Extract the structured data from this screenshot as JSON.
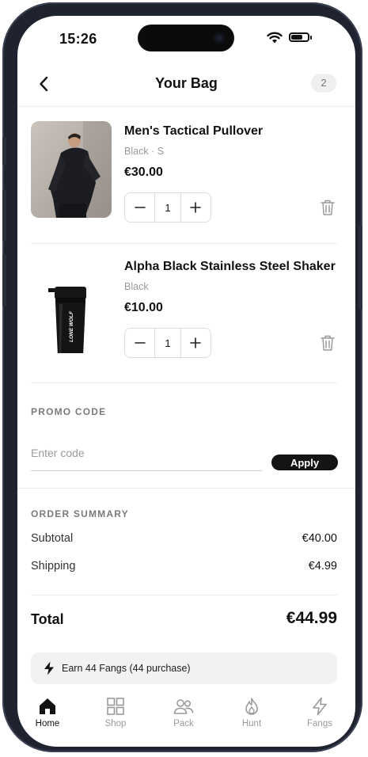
{
  "status_bar": {
    "time": "15:26"
  },
  "header": {
    "title": "Your Bag",
    "item_count": "2"
  },
  "items": [
    {
      "name": "Men's Tactical Pullover",
      "variant": "Black · S",
      "price": "€30.00",
      "quantity": "1"
    },
    {
      "name": "Alpha Black Stainless Steel Shaker",
      "variant": "Black",
      "price": "€10.00",
      "quantity": "1",
      "bottle_text": "LONE WOLF"
    }
  ],
  "promo": {
    "label": "PROMO CODE",
    "placeholder": "Enter code",
    "apply_label": "Apply"
  },
  "summary": {
    "label": "ORDER SUMMARY",
    "subtotal_label": "Subtotal",
    "subtotal_value": "€40.00",
    "shipping_label": "Shipping",
    "shipping_value": "€4.99",
    "total_label": "Total",
    "total_value": "€44.99"
  },
  "rewards": {
    "text": "Earn 44 Fangs (44 purchase)",
    "icon": "bolt-icon"
  },
  "tabs": [
    {
      "label": "Home",
      "icon": "home-icon",
      "active": true
    },
    {
      "label": "Shop",
      "icon": "grid-icon",
      "active": false
    },
    {
      "label": "Pack",
      "icon": "users-icon",
      "active": false
    },
    {
      "label": "Hunt",
      "icon": "flame-icon",
      "active": false
    },
    {
      "label": "Fangs",
      "icon": "bolt-icon",
      "active": false
    }
  ],
  "colors": {
    "accent": "#141414",
    "muted": "#9a9a9a",
    "divider": "#ececec",
    "frame": "#1f2330"
  }
}
